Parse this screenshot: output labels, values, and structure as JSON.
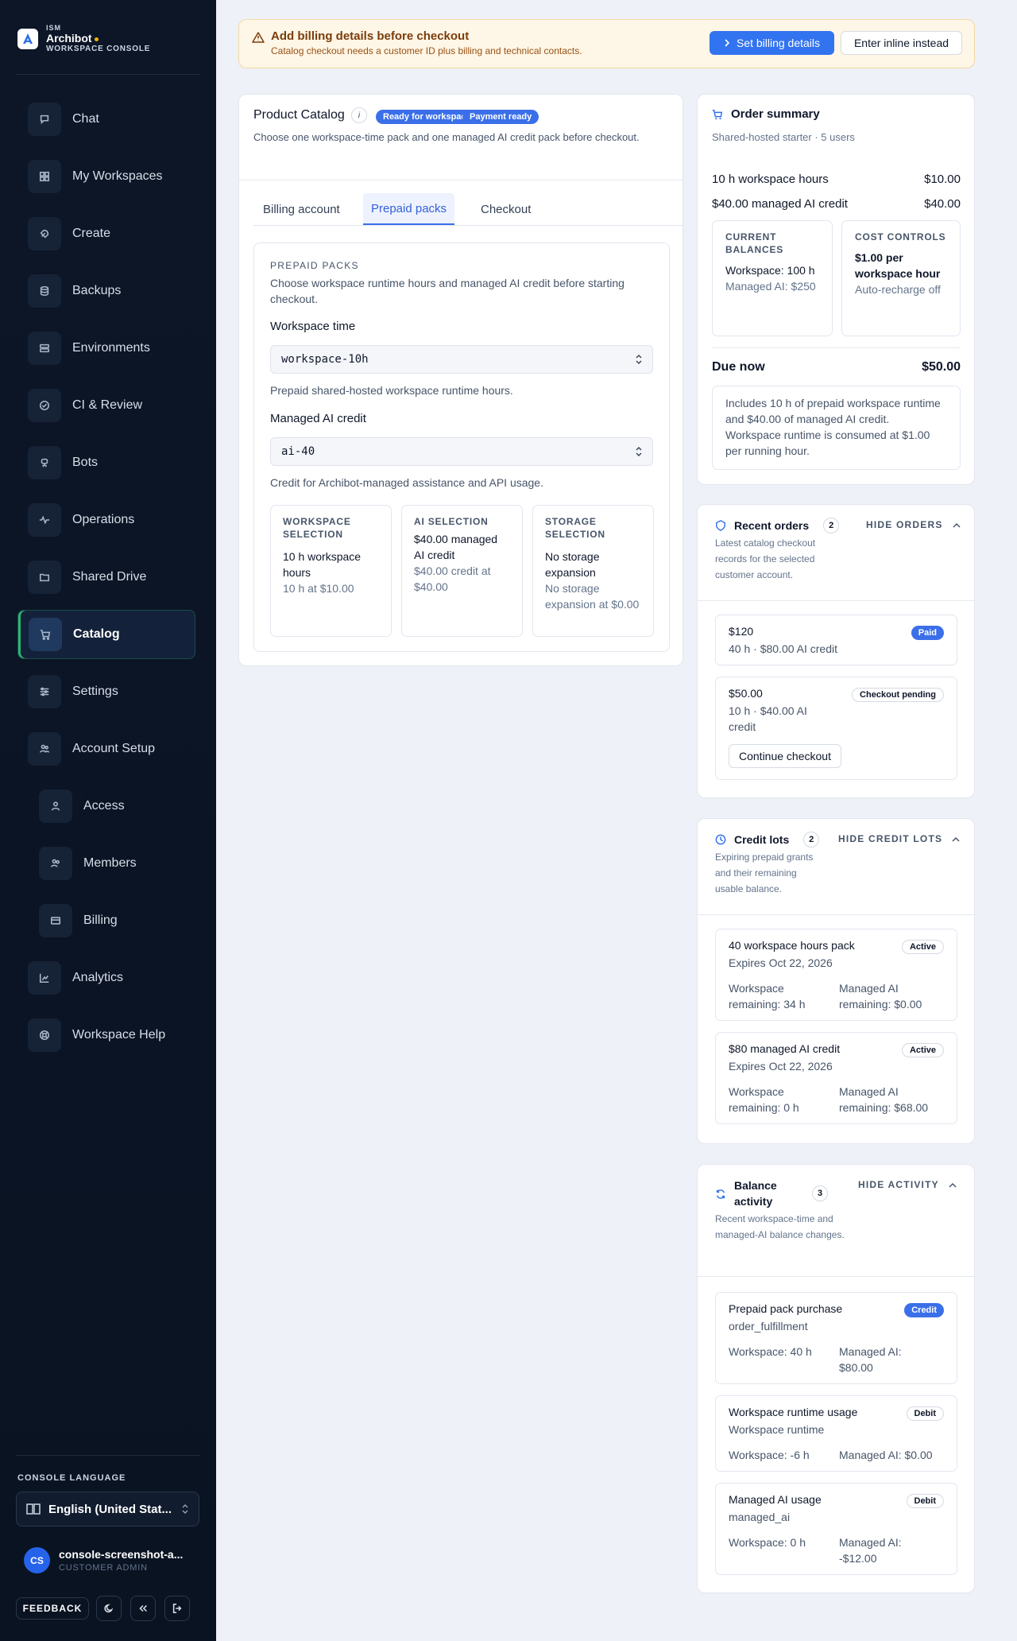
{
  "brand": {
    "small": "ISM",
    "name": "Archibot",
    "sub": "WORKSPACE CONSOLE"
  },
  "nav": [
    {
      "label": "Chat",
      "icon": "chat-icon"
    },
    {
      "label": "My Workspaces",
      "icon": "grid-icon"
    },
    {
      "label": "Create",
      "icon": "rocket-icon"
    },
    {
      "label": "Backups",
      "icon": "database-icon"
    },
    {
      "label": "Environments",
      "icon": "server-icon"
    },
    {
      "label": "CI & Review",
      "icon": "check-circle-icon"
    },
    {
      "label": "Bots",
      "icon": "bot-icon"
    },
    {
      "label": "Operations",
      "icon": "activity-icon"
    },
    {
      "label": "Shared Drive",
      "icon": "folder-icon"
    },
    {
      "label": "Catalog",
      "icon": "cart-icon",
      "active": true
    },
    {
      "label": "Settings",
      "icon": "sliders-icon"
    },
    {
      "label": "Account Setup",
      "icon": "users-icon"
    },
    {
      "label": "Access",
      "icon": "user-icon",
      "sub": true
    },
    {
      "label": "Members",
      "icon": "user-group-icon",
      "sub": true
    },
    {
      "label": "Billing",
      "icon": "credit-card-icon",
      "sub": true
    },
    {
      "label": "Analytics",
      "icon": "chart-icon"
    },
    {
      "label": "Workspace Help",
      "icon": "lifebuoy-icon"
    }
  ],
  "sidebar_footer": {
    "language_label": "CONSOLE LANGUAGE",
    "language_value": "English (United Stat...",
    "user_initials": "CS",
    "user_name": "console-screenshot-a...",
    "user_role": "CUSTOMER ADMIN",
    "feedback": "FEEDBACK"
  },
  "alert": {
    "title": "Add billing details before checkout",
    "sub": "Catalog checkout needs a customer ID plus billing and technical contacts.",
    "primary": "Set billing details",
    "secondary": "Enter inline instead"
  },
  "catalog": {
    "title": "Product Catalog",
    "info": "i",
    "badges": [
      "Ready for workspaces",
      "Payment ready"
    ],
    "desc": "Choose one workspace-time pack and one managed AI credit pack before checkout.",
    "tabs": [
      "Billing account",
      "Prepaid packs",
      "Checkout"
    ],
    "kicker": "PREPAID PACKS",
    "section_desc": "Choose workspace runtime hours and managed AI credit before starting checkout.",
    "workspace_label": "Workspace time",
    "workspace_value": "workspace-10h",
    "workspace_help": "Prepaid shared-hosted workspace runtime hours.",
    "ai_label": "Managed AI credit",
    "ai_value": "ai-40",
    "ai_help": "Credit for Archibot-managed assistance and API usage.",
    "summary": [
      {
        "k": "WORKSPACE SELECTION",
        "v": "10 h workspace hours",
        "s": "10 h at $10.00"
      },
      {
        "k": "AI SELECTION",
        "v": "$40.00 managed AI credit",
        "s": "$40.00 credit at $40.00"
      },
      {
        "k": "STORAGE SELECTION",
        "v": "No storage expansion",
        "s": "No storage expansion at $0.00"
      }
    ]
  },
  "order": {
    "title": "Order summary",
    "sub": "Shared-hosted starter · 5 users",
    "lines": [
      {
        "label": "10 h workspace hours",
        "amount": "$10.00"
      },
      {
        "label": "$40.00 managed AI credit",
        "amount": "$40.00"
      }
    ],
    "balances_k": "CURRENT BALANCES",
    "balances_v": "Workspace: 100 h",
    "balances_s": "Managed AI: $250",
    "cost_k": "COST CONTROLS",
    "cost_v": "$1.00 per workspace hour",
    "cost_s": "Auto-recharge off",
    "due_label": "Due now",
    "due_amount": "$50.00",
    "note": "Includes 10 h of prepaid workspace runtime and $40.00 of managed AI credit. Workspace runtime is consumed at $1.00 per running hour."
  },
  "recent": {
    "title": "Recent orders",
    "count": "2",
    "hide": "HIDE ORDERS",
    "sub": "Latest catalog checkout records for the selected customer account.",
    "items": [
      {
        "amount": "$120",
        "detail": "40 h · $80.00 AI credit",
        "badge": "Paid"
      },
      {
        "amount": "$50.00",
        "detail": "10 h · $40.00 AI credit",
        "badge": "Checkout pending",
        "action": "Continue checkout"
      }
    ]
  },
  "lots": {
    "title": "Credit lots",
    "count": "2",
    "hide": "HIDE CREDIT LOTS",
    "sub": "Expiring prepaid grants and their remaining usable balance.",
    "items": [
      {
        "title": "40 workspace hours pack",
        "expires": "Expires Oct 22, 2026",
        "badge": "Active",
        "ws": "Workspace remaining: 34 h",
        "ai": "Managed AI remaining: $0.00"
      },
      {
        "title": "$80 managed AI credit",
        "expires": "Expires Oct 22, 2026",
        "badge": "Active",
        "ws": "Workspace remaining: 0 h",
        "ai": "Managed AI remaining: $68.00"
      }
    ]
  },
  "activity": {
    "title": "Balance activity",
    "count": "3",
    "hide": "HIDE ACTIVITY",
    "sub": "Recent workspace-time and managed-AI balance changes.",
    "items": [
      {
        "title": "Prepaid pack purchase",
        "source": "order_fulfillment",
        "badge": "Credit",
        "ws": "Workspace: 40 h",
        "ai": "Managed AI: $80.00"
      },
      {
        "title": "Workspace runtime usage",
        "source": "Workspace runtime",
        "badge": "Debit",
        "ws": "Workspace: -6 h",
        "ai": "Managed AI: $0.00"
      },
      {
        "title": "Managed AI usage",
        "source": "managed_ai",
        "badge": "Debit",
        "ws": "Workspace: 0 h",
        "ai": "Managed AI: -$12.00"
      }
    ]
  }
}
